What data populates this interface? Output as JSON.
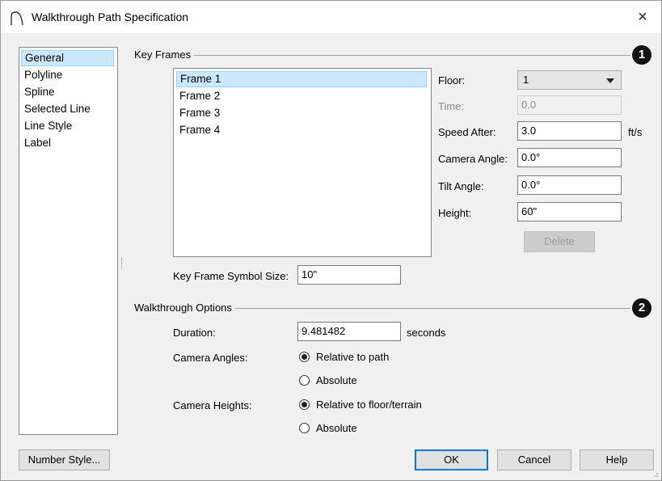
{
  "window": {
    "title": "Walkthrough Path Specification",
    "close_glyph": "×"
  },
  "sidebar": {
    "items": [
      {
        "label": "General",
        "selected": true
      },
      {
        "label": "Polyline"
      },
      {
        "label": "Spline"
      },
      {
        "label": "Selected Line"
      },
      {
        "label": "Line Style"
      },
      {
        "label": "Label"
      }
    ]
  },
  "key_frames": {
    "group_label": "Key Frames",
    "badge": "1",
    "frames": [
      "Frame 1",
      "Frame 2",
      "Frame 3",
      "Frame 4"
    ],
    "selected_frame": "Frame 1",
    "floor": {
      "label": "Floor:",
      "value": "1"
    },
    "time": {
      "label": "Time:",
      "value": "0.0",
      "disabled": true
    },
    "speed_after": {
      "label": "Speed After:",
      "value": "3.0",
      "unit": "ft/s"
    },
    "camera_angle": {
      "label": "Camera Angle:",
      "value": "0.0°"
    },
    "tilt_angle": {
      "label": "Tilt Angle:",
      "value": "0.0°"
    },
    "height": {
      "label": "Height:",
      "value": "60\""
    },
    "delete_label": "Delete",
    "symbol_size": {
      "label": "Key Frame Symbol Size:",
      "value": "10\""
    }
  },
  "walkthrough_options": {
    "group_label": "Walkthrough Options",
    "badge": "2",
    "duration": {
      "label": "Duration:",
      "value": "9.481482",
      "unit": "seconds"
    },
    "camera_angles": {
      "label": "Camera Angles:",
      "options": [
        "Relative to path",
        "Absolute"
      ],
      "selected": "Relative to path"
    },
    "camera_heights": {
      "label": "Camera Heights:",
      "options": [
        "Relative to floor/terrain",
        "Absolute"
      ],
      "selected": "Relative to floor/terrain"
    }
  },
  "footer": {
    "number_style_label": "Number Style...",
    "ok_label": "OK",
    "cancel_label": "Cancel",
    "help_label": "Help"
  },
  "icons": {
    "title_icon": "arch-icon",
    "close_icon": "close-icon",
    "dropdown_icon": "chevron-down-icon"
  }
}
